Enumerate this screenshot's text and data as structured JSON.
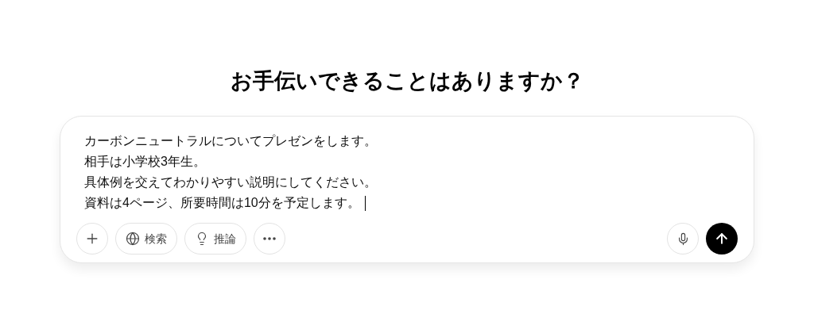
{
  "heading": "お手伝いできることはありますか？",
  "composer": {
    "lines": [
      "カーボンニュートラルについてプレゼンをします。",
      "相手は小学校3年生。",
      "具体例を交えてわかりやすい説明にしてください。",
      "資料は4ページ、所要時間は10分を予定します。"
    ],
    "tools": [
      {
        "kind": "plus"
      },
      {
        "kind": "globe",
        "label": "検索"
      },
      {
        "kind": "bulb",
        "label": "推論"
      },
      {
        "kind": "more"
      }
    ]
  }
}
